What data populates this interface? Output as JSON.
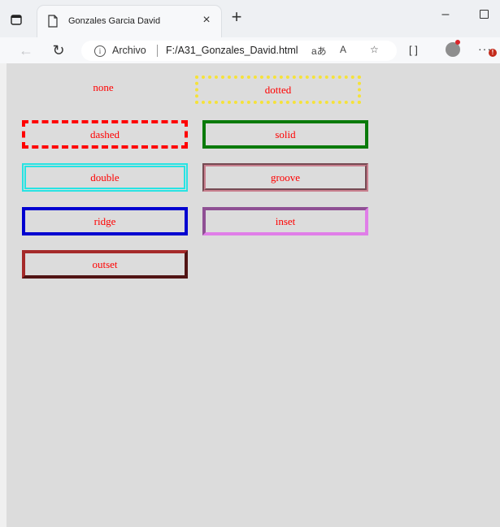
{
  "browser": {
    "tab_title": "Gonzales Garcia David",
    "close_glyph": "×",
    "newtab_glyph": "+",
    "address_label": "Archivo",
    "url": "F:/A31_Gonzales_David.html",
    "alert_badge": "!"
  },
  "page": {
    "boxes": [
      {
        "label": "none",
        "border_style": "none",
        "border_color": "#000000"
      },
      {
        "label": "dotted",
        "border_style": "dotted",
        "border_color": "#f5e23a"
      },
      {
        "label": "dashed",
        "border_style": "dashed",
        "border_color": "#ff0000"
      },
      {
        "label": "solid",
        "border_style": "solid",
        "border_color": "#0a7a0a"
      },
      {
        "label": "double",
        "border_style": "double",
        "border_color": "#27e3e3"
      },
      {
        "label": "groove",
        "border_style": "groove",
        "border_color": "#c9808f"
      },
      {
        "label": "ridge",
        "border_style": "ridge",
        "border_color": "#0000d0"
      },
      {
        "label": "inset",
        "border_style": "inset",
        "border_color": "#e07ee8"
      },
      {
        "label": "outset",
        "border_style": "outset",
        "border_color": "#a52a2a"
      }
    ],
    "text_color": "#ff0000",
    "background": "#dcdcdc"
  }
}
